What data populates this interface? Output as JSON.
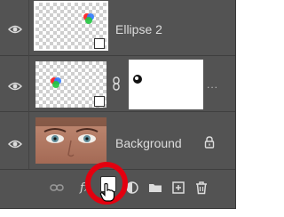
{
  "layers_panel": {
    "layers": [
      {
        "name": "Ellipse 2",
        "visible": true,
        "selected": true,
        "type": "shape"
      },
      {
        "name": "",
        "visible": true,
        "selected": false,
        "type": "shape-with-mask"
      },
      {
        "name": "Background",
        "visible": true,
        "selected": false,
        "type": "image",
        "locked": true
      }
    ],
    "more_indicator": "...",
    "toolbar": {
      "fx_label": "fx",
      "icons": [
        "link-layers-icon",
        "fx-icon",
        "add-layer-mask-icon",
        "adjustment-layer-icon",
        "group-folder-icon",
        "new-layer-icon",
        "trash-icon"
      ]
    }
  },
  "colors": {
    "panel_bg": "#535353",
    "text": "#dcdcdc",
    "highlight_ring": "#e3000f"
  }
}
